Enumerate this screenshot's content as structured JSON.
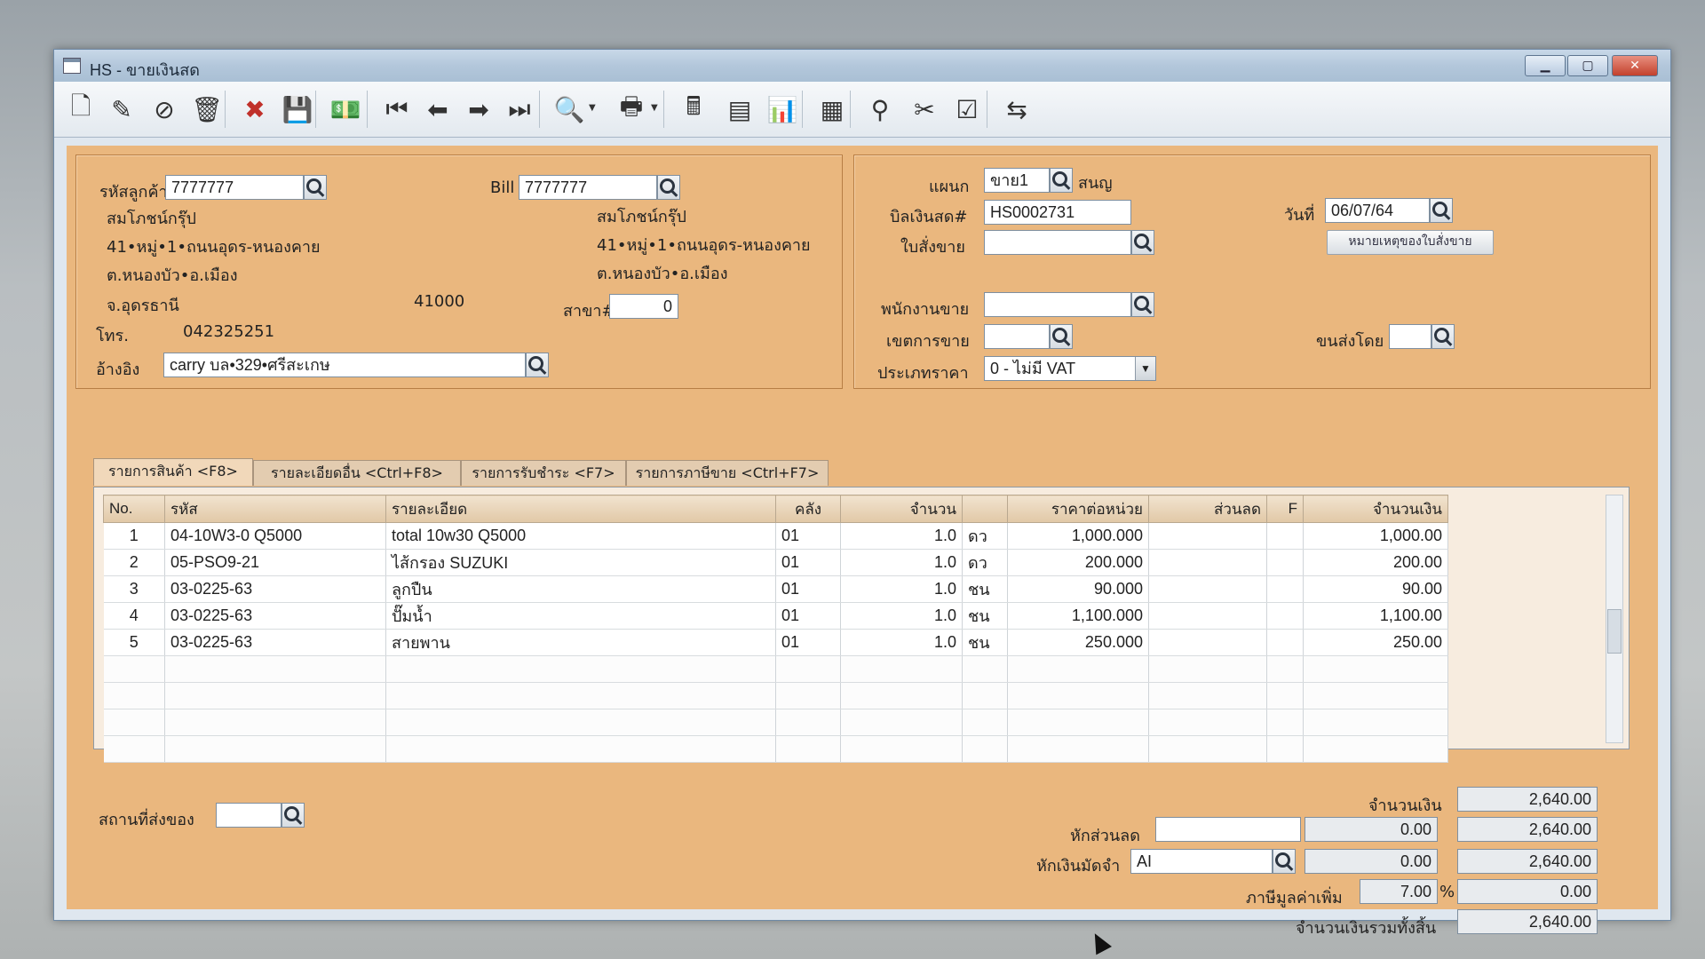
{
  "window": {
    "title": "HS - ขายเงินสด",
    "controls": {
      "minimize": "▁",
      "maximize": "▢",
      "close": "✕"
    }
  },
  "toolbar": {
    "buttons": [
      {
        "name": "new-document-icon",
        "glyph": "🗋"
      },
      {
        "name": "edit-icon",
        "glyph": "✎"
      },
      {
        "name": "void-icon",
        "glyph": "⊘"
      },
      {
        "name": "trash-icon",
        "glyph": "🗑"
      },
      {
        "name": "cancel-icon",
        "glyph": "✖"
      },
      {
        "name": "save-icon",
        "glyph": "💾"
      },
      {
        "name": "money-icon",
        "glyph": "💵"
      },
      {
        "name": "first-record-icon",
        "glyph": "⏮"
      },
      {
        "name": "previous-record-icon",
        "glyph": "⬅"
      },
      {
        "name": "next-record-icon",
        "glyph": "➡"
      },
      {
        "name": "last-record-icon",
        "glyph": "⏭"
      },
      {
        "name": "search-document-icon",
        "glyph": "🔍"
      },
      {
        "name": "print-icon",
        "glyph": "🖶"
      },
      {
        "name": "calculator-icon",
        "glyph": "🖩"
      },
      {
        "name": "register-icon",
        "glyph": "▤"
      },
      {
        "name": "chart-icon",
        "glyph": "📊"
      },
      {
        "name": "report-icon",
        "glyph": "▦"
      },
      {
        "name": "ok-person-icon",
        "glyph": "⚲"
      },
      {
        "name": "scissors-icon",
        "glyph": "✂"
      },
      {
        "name": "ok-icon",
        "glyph": "☑"
      },
      {
        "name": "transfer-icon",
        "glyph": "⇆"
      }
    ]
  },
  "customer": {
    "code_label": "รหัสลูกค้า",
    "code": "7777777",
    "name": "สมโภชน์กรุ๊ป",
    "address1": "41•หมู่•1•ถนนอุดร-หนองคาย",
    "address2": "ต.หนองบัว•อ.เมือง",
    "province": "จ.อุดรธานี",
    "zip": "41000",
    "phone_label": "โทร.",
    "phone": "042325251",
    "ref_label": "อ้างอิง",
    "ref": "carry  บล•329•ศรีสะเกษ"
  },
  "bill_to": {
    "label": "Bill to",
    "code": "7777777",
    "name": "สมโภชน์กรุ๊ป",
    "address1": "41•หมู่•1•ถนนอุดร-หนองคาย",
    "address2": "ต.หนองบัว•อ.เมือง",
    "branch_label": "สาขา#",
    "branch": "0"
  },
  "doc": {
    "dept_label": "แผนก",
    "dept": "ขาย1",
    "dept_name": "สนญ",
    "bill_label": "บิลเงินสด#",
    "bill_no": "HS0002731",
    "date_label": "วันที่",
    "date": "06/07/64",
    "order_label": "ใบสั่งขาย",
    "order": "",
    "note_button": "หมายเหตุของใบสั่งขาย",
    "salesman_label": "พนักงานขาย",
    "salesman": "",
    "area_label": "เขตการขาย",
    "area": "",
    "ship_label": "ขนส่งโดย",
    "ship": "",
    "price_type_label": "ประเภทราคา",
    "price_type": "0 - ไม่มี VAT"
  },
  "tabs": [
    {
      "label": "รายการสินค้า <F8>"
    },
    {
      "label": "รายละเอียดอื่น <Ctrl+F8>"
    },
    {
      "label": "รายการรับชำระ <F7>"
    },
    {
      "label": "รายการภาษีขาย <Ctrl+F7>"
    }
  ],
  "grid": {
    "headers": [
      "No.",
      "รหัส",
      "รายละเอียด",
      "คลัง",
      "จำนวน",
      "",
      "ราคาต่อหน่วย",
      "ส่วนลด",
      "F",
      "จำนวนเงิน"
    ],
    "rows": [
      [
        "1",
        "04-10W3-0 Q5000",
        "total 10w30 Q5000",
        "01",
        "1.0",
        "ดว",
        "1,000.000",
        "",
        "",
        "1,000.00"
      ],
      [
        "2",
        "05-PSO9-21",
        "ไส้กรอง SUZUKI",
        "01",
        "1.0",
        "ดว",
        "200.000",
        "",
        "",
        "200.00"
      ],
      [
        "3",
        "03-0225-63",
        "ลูกปืน",
        "01",
        "1.0",
        "ชน",
        "90.000",
        "",
        "",
        "90.00"
      ],
      [
        "4",
        "03-0225-63",
        "ปั๊มน้ำ",
        "01",
        "1.0",
        "ชน",
        "1,100.000",
        "",
        "",
        "1,100.00"
      ],
      [
        "5",
        "03-0225-63",
        "สายพาน",
        "01",
        "1.0",
        "ชน",
        "250.000",
        "",
        "",
        "250.00"
      ]
    ]
  },
  "footer": {
    "ship_place_label": "สถานที่ส่งของ",
    "ship_place": "",
    "amount_label": "จำนวนเงิน",
    "amount": "2,640.00",
    "discount_label": "หักส่วนลด",
    "discount_text": "",
    "discount_value": "0.00",
    "discount_total": "2,640.00",
    "deposit_label": "หักเงินมัดจำ",
    "deposit_code": "AI",
    "deposit_value": "0.00",
    "deposit_total": "2,640.00",
    "vat_label": "ภาษีมูลค่าเพิ่ม",
    "vat_rate": "7.00",
    "vat_pct": "%",
    "vat_amount": "0.00",
    "grand_total_label": "จำนวนเงินรวมทั้งสิ้น",
    "grand_total": "2,640.00"
  }
}
